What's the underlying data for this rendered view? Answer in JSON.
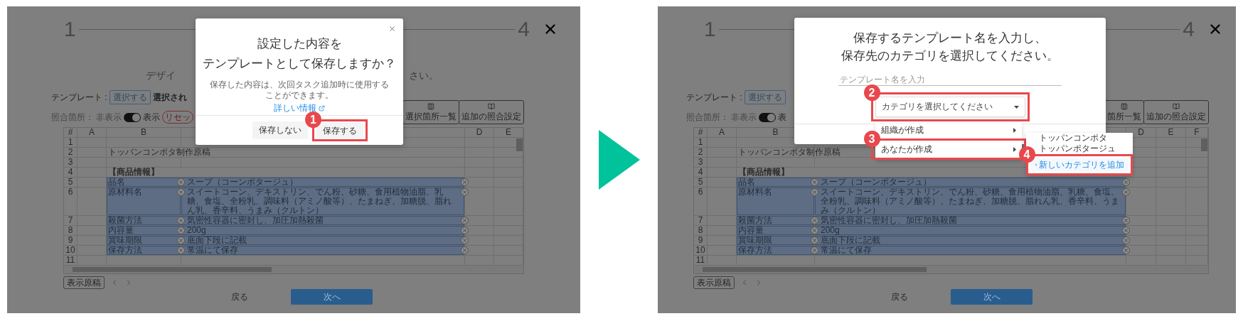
{
  "panels": [
    {
      "stepper": {
        "first": "1",
        "last": "4"
      },
      "heading": [
        "デザイ",
        "さい。"
      ],
      "template_label": "テンプレート :",
      "template_button": "選択する",
      "template_selected": "選択され",
      "match_label": "照合箇所：",
      "hide_label": "非表示",
      "toggle_on": true,
      "show_label": "表示",
      "reset": "リセッ",
      "tool_buttons": [
        {
          "kind": "list",
          "label": "選択箇所一覧"
        },
        {
          "kind": "book",
          "label": "追加の照合設定"
        }
      ],
      "sheet": {
        "columns": [
          "#",
          "A",
          "B",
          "D",
          "E"
        ],
        "rows": [
          {
            "number": "1",
            "selected": false
          },
          {
            "number": "2",
            "b": "トッパンコンポタ制作原稿",
            "selected": false
          },
          {
            "number": "3",
            "selected": false
          },
          {
            "number": "4",
            "b": "【商品情報】",
            "kind": "heading",
            "selected": false
          },
          {
            "number": "5",
            "b": "品名",
            "c": "スープ（コーンポタージュ）",
            "selected": true
          },
          {
            "number": "6",
            "b": "原材料名",
            "c": "スイートコーン、デキストリン、でん粉、砂糖、食用植物油脂、乳糖、食塩、全粉乳、調味料（アミノ酸等）、たまねぎ、加糖脱、脂れん乳、香辛料、うまみ（クルトン）",
            "selected": true
          },
          {
            "number": "7",
            "b": "殺菌方法",
            "c": "気密性容器に密封し、加圧加熱殺菌",
            "selected": true
          },
          {
            "number": "8",
            "b": "内容量",
            "c": "200g",
            "selected": true
          },
          {
            "number": "9",
            "b": "賞味期限",
            "c": "底面下段に記載",
            "selected": true
          },
          {
            "number": "10",
            "b": "保存方法",
            "c": "常温にて保存",
            "selected": true
          },
          {
            "number": "11",
            "selected": false
          }
        ]
      },
      "sheet_tab": "表示原稿",
      "back": "戻る",
      "next": "次へ",
      "dialog": {
        "kind": "confirm",
        "title": [
          "設定した内容を",
          "テンプレートとして保存しますか？"
        ],
        "description": "保存した内容は、次回タスク追加時に使用することができます。",
        "link": "詳しい情報",
        "buttons": [
          {
            "label": "保存しない"
          },
          {
            "label": "保存する",
            "callout": "1"
          }
        ]
      }
    },
    {
      "stepper": {
        "first": "1",
        "last": "4"
      },
      "template_label": "テンプレート :",
      "template_button": "選択する",
      "match_label": "照合箇所：",
      "hide_label": "非表示",
      "toggle_on": true,
      "show_label": "表",
      "tool_buttons": [
        {
          "kind": "list",
          "label": "箇所一覧"
        },
        {
          "kind": "book",
          "label": "追加の照合設定"
        }
      ],
      "sheet": {
        "columns": [
          "#",
          "A",
          "B",
          "D",
          "E",
          "F"
        ],
        "rows": [
          {
            "number": "1",
            "selected": false
          },
          {
            "number": "2",
            "b": "トッパンコンポタ制作原稿",
            "selected": false
          },
          {
            "number": "3",
            "selected": false
          },
          {
            "number": "4",
            "b": "【商品情報】",
            "kind": "heading",
            "selected": false
          },
          {
            "number": "5",
            "b": "品名",
            "c": "スープ（コーンポタージュ）",
            "selected": true
          },
          {
            "number": "6",
            "b": "原材料名",
            "c": "スイートコーン、デキストリン、でん粉、砂糖、食用植物油脂、乳糖、食塩、全粉乳、調味料（アミノ酸等）、たまねぎ、加糖脱、脂れん乳、香辛料、うまみ（クルトン）",
            "selected": true
          },
          {
            "number": "7",
            "b": "殺菌方法",
            "c": "気密性容器に密封し、加圧加熱殺菌",
            "selected": true
          },
          {
            "number": "8",
            "b": "内容量",
            "c": "200g",
            "selected": true
          },
          {
            "number": "9",
            "b": "賞味期限",
            "c": "底面下段に記載",
            "selected": true
          },
          {
            "number": "10",
            "b": "保存方法",
            "c": "常温にて保存",
            "selected": true
          },
          {
            "number": "11",
            "selected": false
          }
        ]
      },
      "sheet_tab": "表示原稿",
      "back": "戻る",
      "next": "次へ",
      "dialog": {
        "kind": "save",
        "title": [
          "保存するテンプレート名を入力し、",
          "保存先のカテゴリを選択してください。"
        ],
        "name_placeholder": "テンプレート名を入力",
        "select": {
          "placeholder": "カテゴリを選択してください",
          "callout": "2"
        },
        "menu": [
          {
            "label": "組織が作成"
          },
          {
            "label": "あなたが作成",
            "callout": "3",
            "submenu": [
              {
                "kind": "item",
                "label": "トッパンコンポタ"
              },
              {
                "kind": "item",
                "label": "トッパンポタージュ"
              },
              {
                "kind": "add",
                "label": "新しいカテゴリを追加",
                "callout": "4"
              }
            ]
          }
        ]
      }
    }
  ]
}
